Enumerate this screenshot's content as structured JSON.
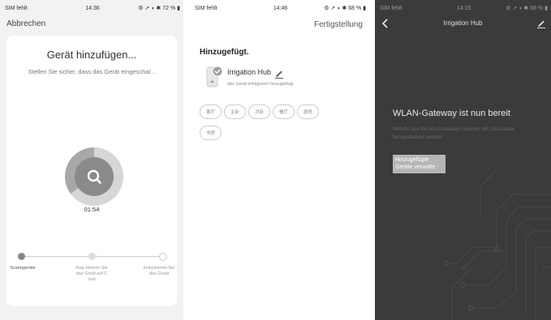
{
  "screens": [
    {
      "status": {
        "carrier": "SIM fehlt",
        "time": "14:36",
        "battery": "72 %"
      },
      "cancel_label": "Abbrechen",
      "title": "Gerät hinzufügen...",
      "subtitle": "Stellen Sie sicher, dass das Gerät eingeschal...",
      "progress_fraction": 0.35,
      "timer": "01:54",
      "steps": [
        {
          "label": "Scanngeräte",
          "active": true,
          "icon": "scan-icon"
        },
        {
          "label": "Reg strieren Sie das Gerät auf C oud",
          "active": false,
          "icon": "cloud-icon"
        },
        {
          "label": "Initialisieren Sie das Gerät",
          "active": false,
          "icon": "check-icon"
        }
      ]
    },
    {
      "status": {
        "carrier": "SIM fehlt",
        "time": "14:46",
        "battery": "68 %"
      },
      "done_label": "Fertigstellung",
      "added_label": "Hinzugefügt.",
      "device_name": "Irrigation Hub",
      "device_sub": "das Gerät erfolgreich hinzugefügt",
      "rooms": [
        "客厅",
        "主卧",
        "次卧",
        "餐厅",
        "厨房",
        "书房"
      ]
    },
    {
      "status": {
        "carrier": "SIM fehlt",
        "time": "14:15",
        "battery": "68 %"
      },
      "title": "Irrigation Hub",
      "heading": "WLAN-Gateway ist nun bereit",
      "description": "Mithilfe des WLAN-Gateways können WLAN-Geräte ferngesteuert werden",
      "button_line1": "Hinzugefügte",
      "button_line2": "Geräte verwalte"
    }
  ],
  "colors": {
    "progress_ring": "#d6d6d6",
    "progress_fill": "#a8a8a8",
    "progress_center": "#8a8a8a",
    "dark_bg": "#3b3b3b"
  }
}
